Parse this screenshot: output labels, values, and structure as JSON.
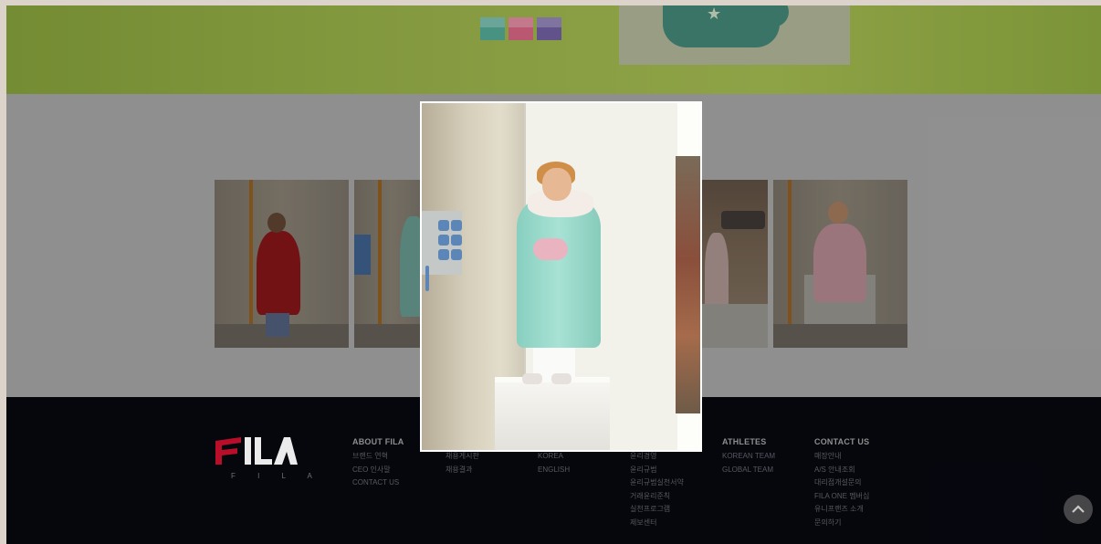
{
  "colors": {
    "swatch_colors": [
      "#4f9f8e",
      "#c9607a",
      "#6a5a98"
    ],
    "footer_bg": "#06080f",
    "logo_red": "#c8102e",
    "logo_white": "#ffffff"
  },
  "banner": {
    "swatch_names": [
      "mint",
      "pink",
      "purple"
    ]
  },
  "footer": {
    "logo_tagline": "F I L A",
    "columns": [
      {
        "heading": "ABOUT FILA",
        "items": [
          "브랜드 연혁",
          "CEO 인사말",
          "CONTACT US"
        ]
      },
      {
        "heading": "",
        "items": [
          "채용게시판",
          "채용결과"
        ]
      },
      {
        "heading": "",
        "items": [
          "KOREA",
          "ENGLISH"
        ]
      },
      {
        "heading": "",
        "items": [
          "윤리경영",
          "윤리규범",
          "윤리규범실천서약",
          "거래윤리준칙",
          "실천프로그램",
          "제보센터"
        ]
      },
      {
        "heading": "ATHLETES",
        "items": [
          "KOREAN TEAM",
          "GLOBAL TEAM"
        ]
      },
      {
        "heading": "CONTACT US",
        "items": [
          "매장안내",
          "A/S 안내조회",
          "대리점개설문의",
          "FILA ONE 멤버십",
          "유니프랜즈 소개",
          "문의하기"
        ]
      }
    ]
  },
  "icons": {
    "scroll_top": "chevron-up-icon",
    "product": "bag-icon"
  }
}
